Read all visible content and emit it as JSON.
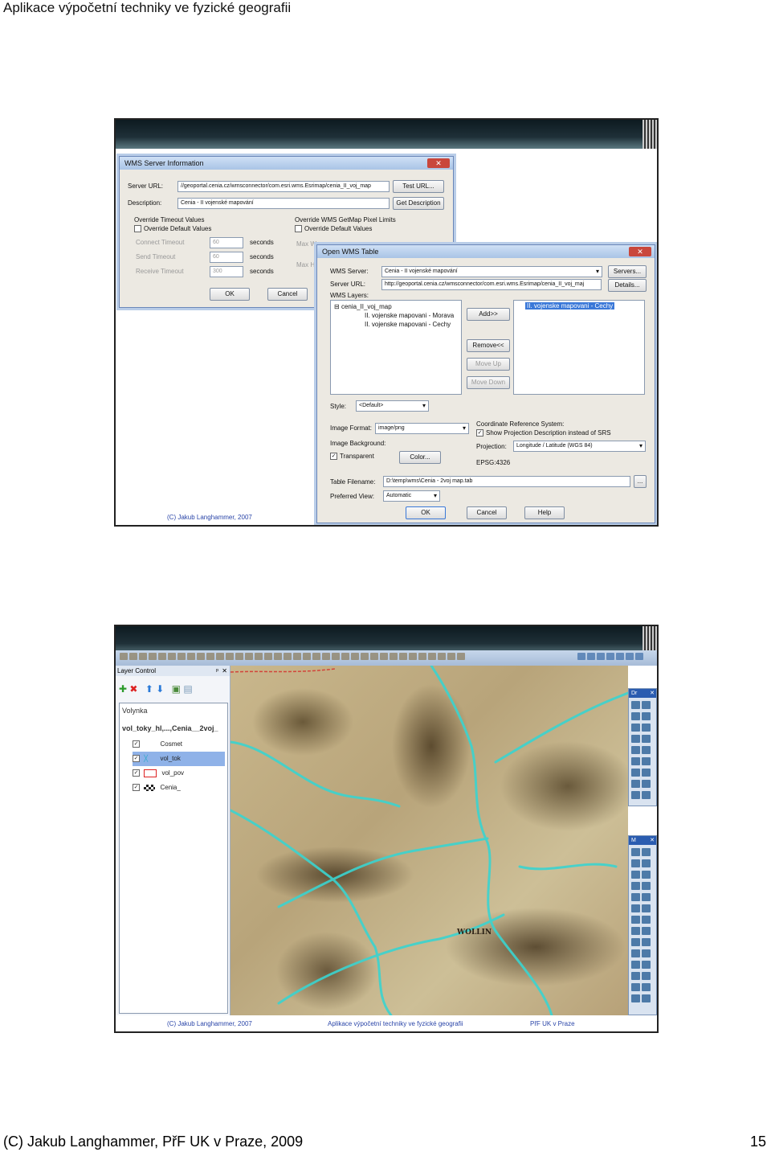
{
  "page": {
    "header": "Aplikace výpočetní techniky ve fyzické geografii",
    "footer_left": "(C) Jakub Langhammer, PřF UK v Praze, 2009",
    "page_number": "15"
  },
  "slide1": {
    "caption": "(C) Jakub Langhammer, 2007",
    "wms_server_info": {
      "title": "WMS Server Information",
      "close": "✕",
      "server_url_label": "Server URL:",
      "server_url_value": "//geoportal.cenia.cz/wmsconnector/com.esri.wms.Esrimap/cenia_II_voj_map",
      "description_label": "Description:",
      "description_value": "Cenia - II vojenské mapování",
      "test_url": "Test URL...",
      "get_description": "Get Description",
      "override_timeout_title": "Override Timeout Values",
      "override_default_values": "Override Default Values",
      "connect_timeout": "Connect Timeout",
      "send_timeout": "Send Timeout",
      "receive_timeout": "Receive Timeout",
      "connect_value": "60",
      "send_value": "60",
      "receive_value": "300",
      "seconds": "seconds",
      "override_pixel_title": "Override WMS GetMap Pixel Limits",
      "override_default_values2": "Override Default Values",
      "max_w": "Max W",
      "max_h": "Max H",
      "ok": "OK",
      "cancel": "Cancel"
    },
    "open_wms": {
      "title": "Open WMS Table",
      "close": "✕",
      "wms_server_label": "WMS Server:",
      "wms_server_value": "Cenia - II vojenské mapování",
      "servers_btn": "Servers...",
      "server_url_label": "Server URL:",
      "server_url_value": "http://geoportal.cenia.cz/wmsconnector/com.esri.wms.Esrimap/cenia_II_voj_maj",
      "details_btn": "Details...",
      "wms_layers_label": "WMS Layers:",
      "tree_root": "cenia_II_voj_map",
      "tree_items": [
        "II. vojenske mapovani - Morava",
        "II. vojenske mapovani - Cechy"
      ],
      "add_btn": "Add>>",
      "remove_btn": "Remove<<",
      "move_up": "Move Up",
      "move_down": "Move Down",
      "selected_layer": "II. vojenske mapovani - Cechy",
      "style_label": "Style:",
      "style_value": "<Default>",
      "image_format_label": "Image Format:",
      "image_format_value": "image/png",
      "image_background_label": "Image Background:",
      "transparent_label": "Transparent",
      "color_btn": "Color...",
      "crs_title": "Coordinate Reference System:",
      "show_proj_desc": "Show Projection Description instead of SRS",
      "projection_label": "Projection:",
      "projection_value": "Longitude / Latitude (WGS 84)",
      "epsg": "EPSG:4326",
      "table_filename_label": "Table Filename:",
      "table_filename_value": "D:\\temp\\wms\\Cenia - 2voj map.tab",
      "browse_btn": "...",
      "preferred_view_label": "Preferred View:",
      "preferred_view_value": "Automatic",
      "ok": "OK",
      "cancel": "Cancel",
      "help": "Help"
    }
  },
  "slide2": {
    "caption_left": "(C) Jakub Langhammer, 2007",
    "caption_center": "Aplikace výpočetní techniky ve fyzické geografii",
    "caption_right": "PřF UK v Praze",
    "layer_control": {
      "title": "Layer Control",
      "pin": "ᵖ",
      "close": "✕",
      "map_name": "Volynka",
      "window_name": "vol_toky_hl,...,Cenia__2voj_",
      "layers": [
        {
          "name": "Cosmet",
          "checked": true
        },
        {
          "name": "vol_tok",
          "checked": true
        },
        {
          "name": "vol_pov",
          "checked": true
        },
        {
          "name": "Cenia_",
          "checked": true
        }
      ]
    },
    "palettes": {
      "draw_title": "Dr",
      "main_title": "M"
    },
    "map_labels": [
      "WOLLIN"
    ],
    "colors": {
      "river": "#3ad4d0",
      "selected_row": "#8fb2e8"
    }
  }
}
